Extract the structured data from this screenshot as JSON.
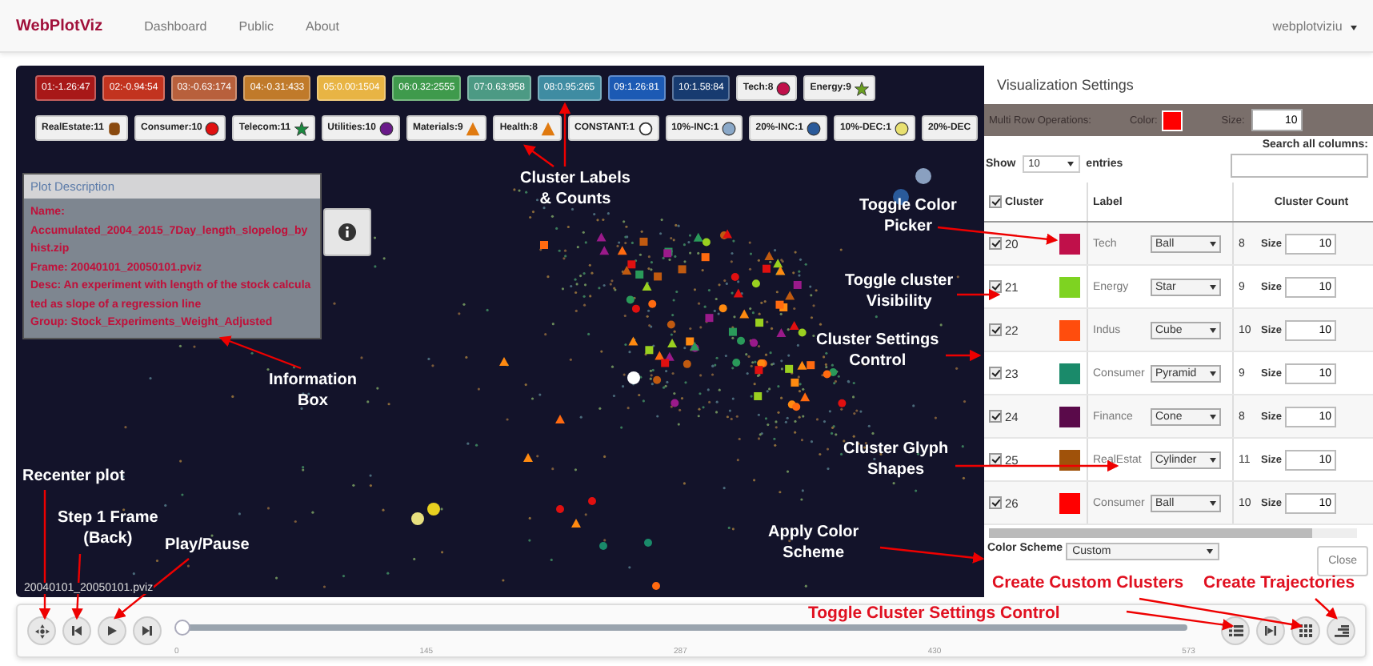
{
  "nav": {
    "brand": "WebPlotViz",
    "links": [
      "Dashboard",
      "Public",
      "About"
    ],
    "user": "webplotviziu"
  },
  "legend": {
    "row_1": [
      {
        "kind": "range",
        "text": "01:-1.26:47",
        "color": "#a81818"
      },
      {
        "kind": "range",
        "text": "02:-0.94:54",
        "color": "#c2331f"
      },
      {
        "kind": "range",
        "text": "03:-0.63:174",
        "color": "#b8603c"
      },
      {
        "kind": "range",
        "text": "04:-0.31:433",
        "color": "#c07a2a"
      },
      {
        "kind": "range",
        "text": "05:0.00:1504",
        "color": "#e8b444"
      },
      {
        "kind": "range",
        "text": "06:0.32:2555",
        "color": "#3f9a4c"
      },
      {
        "kind": "range",
        "text": "07:0.63:958",
        "color": "#4c9a84"
      },
      {
        "kind": "range",
        "text": "08:0.95:265",
        "color": "#3f8ca2"
      },
      {
        "kind": "range",
        "text": "09:1.26:81",
        "color": "#1c5ab4"
      },
      {
        "kind": "range",
        "text": "10:1.58:84",
        "color": "#173b70"
      },
      {
        "kind": "ball",
        "text": "Tech:8",
        "color": "#c0104a"
      },
      {
        "kind": "star",
        "text": "Energy:9",
        "color": "#6aa020"
      }
    ],
    "row_2": [
      {
        "kind": "cylinder",
        "text": "RealEstate:11",
        "color": "#8a4a10"
      },
      {
        "kind": "ball",
        "text": "Consumer:10",
        "color": "#e01010"
      },
      {
        "kind": "star",
        "text": "Telecom:11",
        "color": "#1a8a40"
      },
      {
        "kind": "ball",
        "text": "Utilities:10",
        "color": "#6a1a8a"
      },
      {
        "kind": "cone",
        "text": "Materials:9",
        "color": "#e07a10"
      },
      {
        "kind": "cone",
        "text": "Health:8",
        "color": "#e07a10"
      },
      {
        "kind": "ring",
        "text": "CONSTANT:1",
        "color": "#ffffff"
      },
      {
        "kind": "ball",
        "text": "10%-INC:1",
        "color": "#8aa8c8"
      },
      {
        "kind": "ball",
        "text": "20%-INC:1",
        "color": "#2a5a9a"
      },
      {
        "kind": "ball",
        "text": "10%-DEC:1",
        "color": "#e8e070"
      },
      {
        "kind": "plain",
        "text": "20%-DEC"
      }
    ]
  },
  "plot_description": {
    "title": "Plot Description",
    "lines": [
      "Name:",
      "Accumulated_2004_2015_7Day_length_slopelog_byhist.zip",
      "Frame: 20040101_20050101.pviz",
      "Desc: An experiment with length of the stock calculated as slope of a regression line",
      "Group: Stock_Experiments_Weight_Adjusted"
    ]
  },
  "frame_label": "20040101_20050101.pviz",
  "settings": {
    "title": "Visualization Settings",
    "multi_row": {
      "label": "Multi Row Operations:",
      "color_label": "Color:",
      "color": "#ff0000",
      "size_label": "Size:",
      "size": "10"
    },
    "search_label": "Search all columns:",
    "show_label": "Show",
    "show_value": "10",
    "entries_label": "entries",
    "columns": [
      "Cluster",
      "Label",
      "Cluster Count"
    ],
    "header_checked": true,
    "rows": [
      {
        "cluster": "20",
        "checked": true,
        "color": "#c0104a",
        "label": "Tech",
        "glyph": "Ball",
        "count": "8",
        "size_label": "Size",
        "size": "10"
      },
      {
        "cluster": "21",
        "checked": true,
        "color": "#7ed321",
        "label": "Energy",
        "glyph": "Star",
        "count": "9",
        "size_label": "Size",
        "size": "10"
      },
      {
        "cluster": "22",
        "checked": true,
        "color": "#ff4d0d",
        "label": "Indus",
        "glyph": "Cube",
        "count": "10",
        "size_label": "Size",
        "size": "10"
      },
      {
        "cluster": "23",
        "checked": true,
        "color": "#1a8a6a",
        "label": "Consumer",
        "glyph": "Pyramid",
        "count": "9",
        "size_label": "Size",
        "size": "10"
      },
      {
        "cluster": "24",
        "checked": true,
        "color": "#5a0a4a",
        "label": "Finance",
        "glyph": "Cone",
        "count": "8",
        "size_label": "Size",
        "size": "10"
      },
      {
        "cluster": "25",
        "checked": true,
        "color": "#a0520a",
        "label": "RealEstat",
        "glyph": "Cylinder",
        "count": "11",
        "size_label": "Size",
        "size": "10"
      },
      {
        "cluster": "26",
        "checked": true,
        "color": "#ff0000",
        "label": "Consumer",
        "glyph": "Ball",
        "count": "10",
        "size_label": "Size",
        "size": "10"
      }
    ],
    "color_scheme_label": "Color Scheme",
    "color_scheme": "Custom",
    "close": "Close"
  },
  "player": {
    "level": 0,
    "ticks": [
      "0",
      "145",
      "287",
      "430",
      "573"
    ]
  },
  "annotations": [
    {
      "kind": "light",
      "lines": [
        "Cluster Labels",
        "& Counts"
      ]
    },
    {
      "kind": "light",
      "lines": [
        "Information",
        "Box"
      ]
    },
    {
      "kind": "light",
      "lines": [
        "Toggle Color",
        "Picker"
      ]
    },
    {
      "kind": "light",
      "lines": [
        "Toggle cluster",
        "Visibility"
      ]
    },
    {
      "kind": "light",
      "lines": [
        "Cluster Settings",
        "Control"
      ]
    },
    {
      "kind": "light",
      "lines": [
        "Cluster Glyph",
        "Shapes"
      ]
    },
    {
      "kind": "light",
      "lines": [
        "Apply Color",
        "Scheme"
      ]
    },
    {
      "kind": "light",
      "lines": [
        "Recenter plot"
      ]
    },
    {
      "kind": "light",
      "lines": [
        "Step 1 Frame",
        "(Back)"
      ]
    },
    {
      "kind": "light",
      "lines": [
        "Play/Pause"
      ]
    },
    {
      "kind": "red",
      "lines": [
        "Create Custom Clusters"
      ]
    },
    {
      "kind": "red",
      "lines": [
        "Create Trajectories"
      ]
    },
    {
      "kind": "red",
      "lines": [
        "Toggle Cluster Settings Control"
      ]
    }
  ]
}
